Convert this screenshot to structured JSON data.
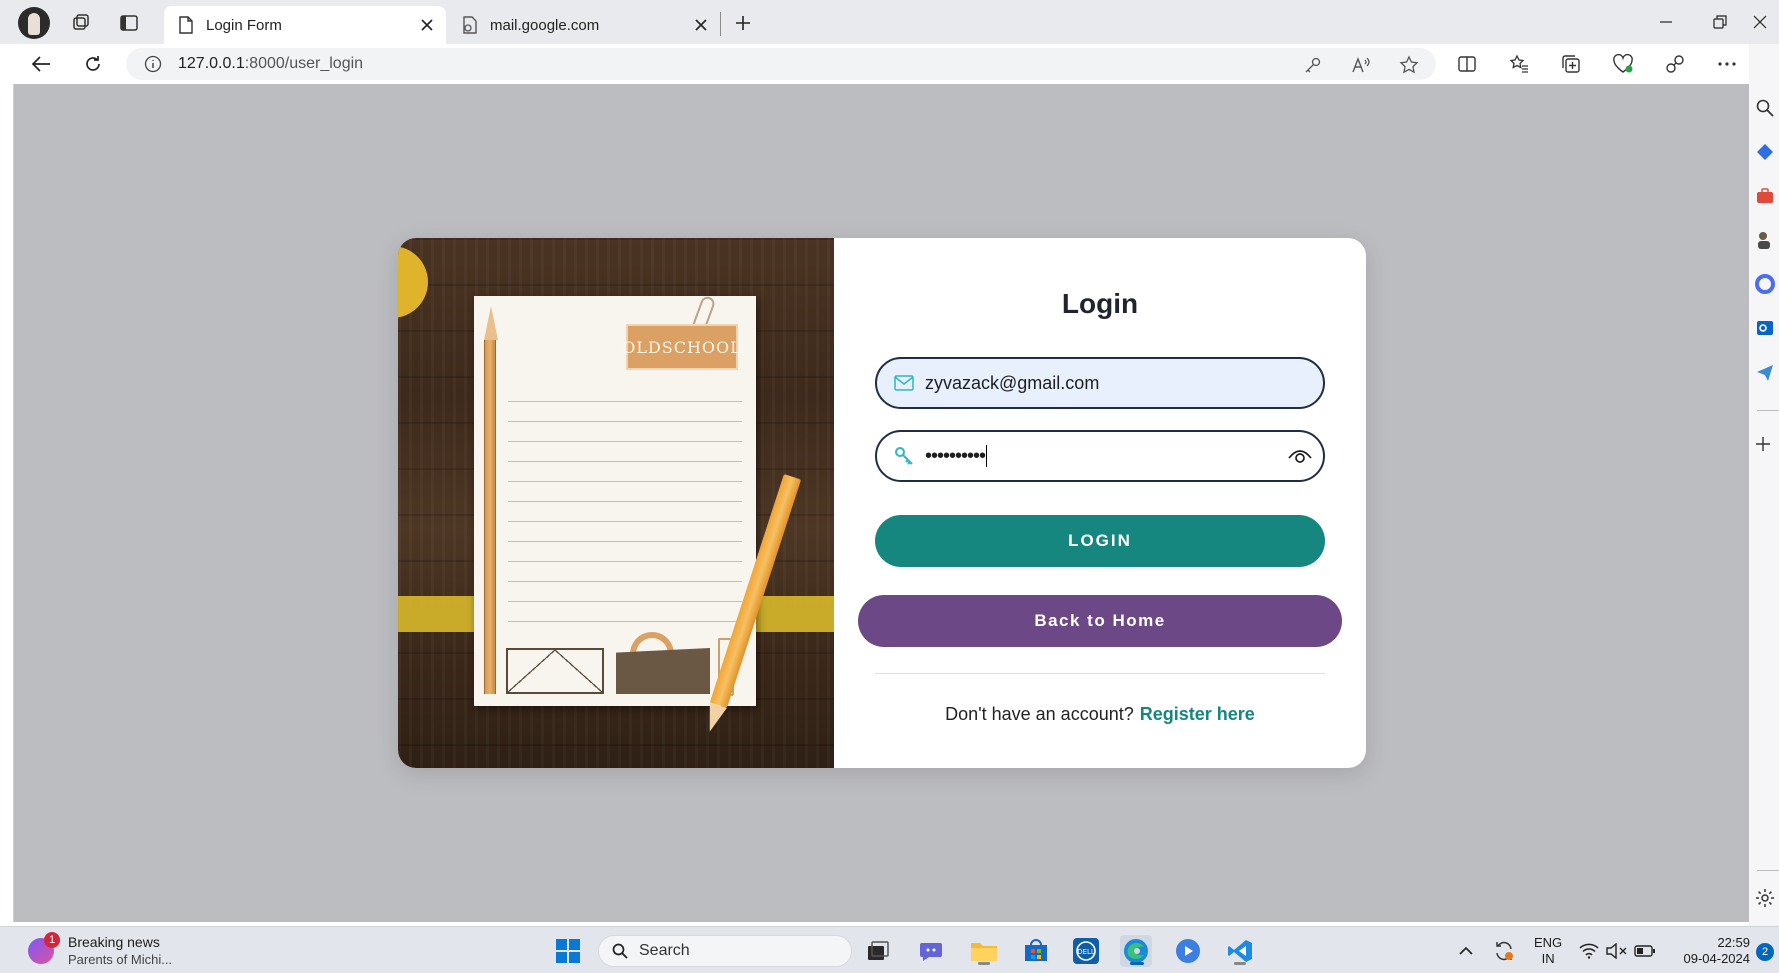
{
  "browser": {
    "tabs": [
      {
        "title": "Login Form",
        "active": true
      },
      {
        "title": "mail.google.com",
        "active": false
      }
    ],
    "url_host": "127.0.0.1",
    "url_path": ":8000/user_login"
  },
  "login": {
    "title": "Login",
    "email_value": "zyvazack@gmail.com",
    "password_value": "••••••••••",
    "login_button": "LOGIN",
    "home_button": "Back to Home",
    "register_prompt": "Don't have an account?",
    "register_link": "Register here",
    "notepad_label": "OLDSCHOOL"
  },
  "taskbar": {
    "news_title": "Breaking news",
    "news_subtitle": "Parents of Michi...",
    "news_badge": "1",
    "search_label": "Search",
    "lang_line1": "ENG",
    "lang_line2": "IN",
    "time": "22:59",
    "date": "09-04-2024",
    "notification_count": "2"
  },
  "colors": {
    "login_button": "#15877f",
    "home_button": "#6d4886",
    "page_background": "#bcbdc0",
    "register_link": "#15877f"
  }
}
